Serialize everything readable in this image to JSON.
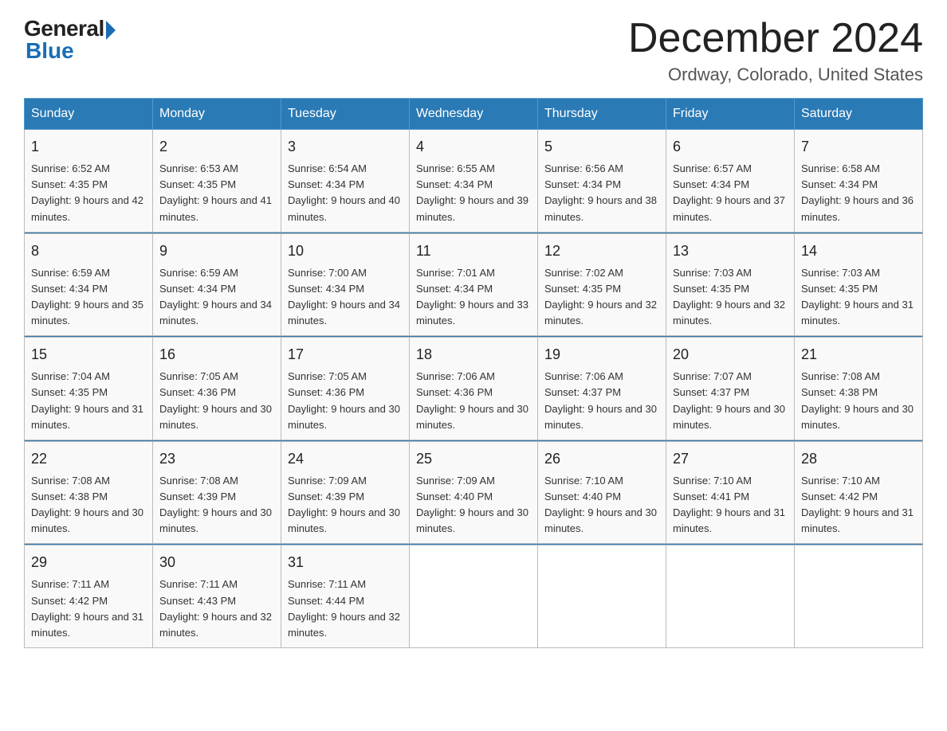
{
  "header": {
    "logo_general": "General",
    "logo_blue": "Blue",
    "main_title": "December 2024",
    "subtitle": "Ordway, Colorado, United States"
  },
  "days_of_week": [
    "Sunday",
    "Monday",
    "Tuesday",
    "Wednesday",
    "Thursday",
    "Friday",
    "Saturday"
  ],
  "weeks": [
    [
      {
        "day": "1",
        "sunrise": "6:52 AM",
        "sunset": "4:35 PM",
        "daylight": "9 hours and 42 minutes."
      },
      {
        "day": "2",
        "sunrise": "6:53 AM",
        "sunset": "4:35 PM",
        "daylight": "9 hours and 41 minutes."
      },
      {
        "day": "3",
        "sunrise": "6:54 AM",
        "sunset": "4:34 PM",
        "daylight": "9 hours and 40 minutes."
      },
      {
        "day": "4",
        "sunrise": "6:55 AM",
        "sunset": "4:34 PM",
        "daylight": "9 hours and 39 minutes."
      },
      {
        "day": "5",
        "sunrise": "6:56 AM",
        "sunset": "4:34 PM",
        "daylight": "9 hours and 38 minutes."
      },
      {
        "day": "6",
        "sunrise": "6:57 AM",
        "sunset": "4:34 PM",
        "daylight": "9 hours and 37 minutes."
      },
      {
        "day": "7",
        "sunrise": "6:58 AM",
        "sunset": "4:34 PM",
        "daylight": "9 hours and 36 minutes."
      }
    ],
    [
      {
        "day": "8",
        "sunrise": "6:59 AM",
        "sunset": "4:34 PM",
        "daylight": "9 hours and 35 minutes."
      },
      {
        "day": "9",
        "sunrise": "6:59 AM",
        "sunset": "4:34 PM",
        "daylight": "9 hours and 34 minutes."
      },
      {
        "day": "10",
        "sunrise": "7:00 AM",
        "sunset": "4:34 PM",
        "daylight": "9 hours and 34 minutes."
      },
      {
        "day": "11",
        "sunrise": "7:01 AM",
        "sunset": "4:34 PM",
        "daylight": "9 hours and 33 minutes."
      },
      {
        "day": "12",
        "sunrise": "7:02 AM",
        "sunset": "4:35 PM",
        "daylight": "9 hours and 32 minutes."
      },
      {
        "day": "13",
        "sunrise": "7:03 AM",
        "sunset": "4:35 PM",
        "daylight": "9 hours and 32 minutes."
      },
      {
        "day": "14",
        "sunrise": "7:03 AM",
        "sunset": "4:35 PM",
        "daylight": "9 hours and 31 minutes."
      }
    ],
    [
      {
        "day": "15",
        "sunrise": "7:04 AM",
        "sunset": "4:35 PM",
        "daylight": "9 hours and 31 minutes."
      },
      {
        "day": "16",
        "sunrise": "7:05 AM",
        "sunset": "4:36 PM",
        "daylight": "9 hours and 30 minutes."
      },
      {
        "day": "17",
        "sunrise": "7:05 AM",
        "sunset": "4:36 PM",
        "daylight": "9 hours and 30 minutes."
      },
      {
        "day": "18",
        "sunrise": "7:06 AM",
        "sunset": "4:36 PM",
        "daylight": "9 hours and 30 minutes."
      },
      {
        "day": "19",
        "sunrise": "7:06 AM",
        "sunset": "4:37 PM",
        "daylight": "9 hours and 30 minutes."
      },
      {
        "day": "20",
        "sunrise": "7:07 AM",
        "sunset": "4:37 PM",
        "daylight": "9 hours and 30 minutes."
      },
      {
        "day": "21",
        "sunrise": "7:08 AM",
        "sunset": "4:38 PM",
        "daylight": "9 hours and 30 minutes."
      }
    ],
    [
      {
        "day": "22",
        "sunrise": "7:08 AM",
        "sunset": "4:38 PM",
        "daylight": "9 hours and 30 minutes."
      },
      {
        "day": "23",
        "sunrise": "7:08 AM",
        "sunset": "4:39 PM",
        "daylight": "9 hours and 30 minutes."
      },
      {
        "day": "24",
        "sunrise": "7:09 AM",
        "sunset": "4:39 PM",
        "daylight": "9 hours and 30 minutes."
      },
      {
        "day": "25",
        "sunrise": "7:09 AM",
        "sunset": "4:40 PM",
        "daylight": "9 hours and 30 minutes."
      },
      {
        "day": "26",
        "sunrise": "7:10 AM",
        "sunset": "4:40 PM",
        "daylight": "9 hours and 30 minutes."
      },
      {
        "day": "27",
        "sunrise": "7:10 AM",
        "sunset": "4:41 PM",
        "daylight": "9 hours and 31 minutes."
      },
      {
        "day": "28",
        "sunrise": "7:10 AM",
        "sunset": "4:42 PM",
        "daylight": "9 hours and 31 minutes."
      }
    ],
    [
      {
        "day": "29",
        "sunrise": "7:11 AM",
        "sunset": "4:42 PM",
        "daylight": "9 hours and 31 minutes."
      },
      {
        "day": "30",
        "sunrise": "7:11 AM",
        "sunset": "4:43 PM",
        "daylight": "9 hours and 32 minutes."
      },
      {
        "day": "31",
        "sunrise": "7:11 AM",
        "sunset": "4:44 PM",
        "daylight": "9 hours and 32 minutes."
      },
      null,
      null,
      null,
      null
    ]
  ]
}
